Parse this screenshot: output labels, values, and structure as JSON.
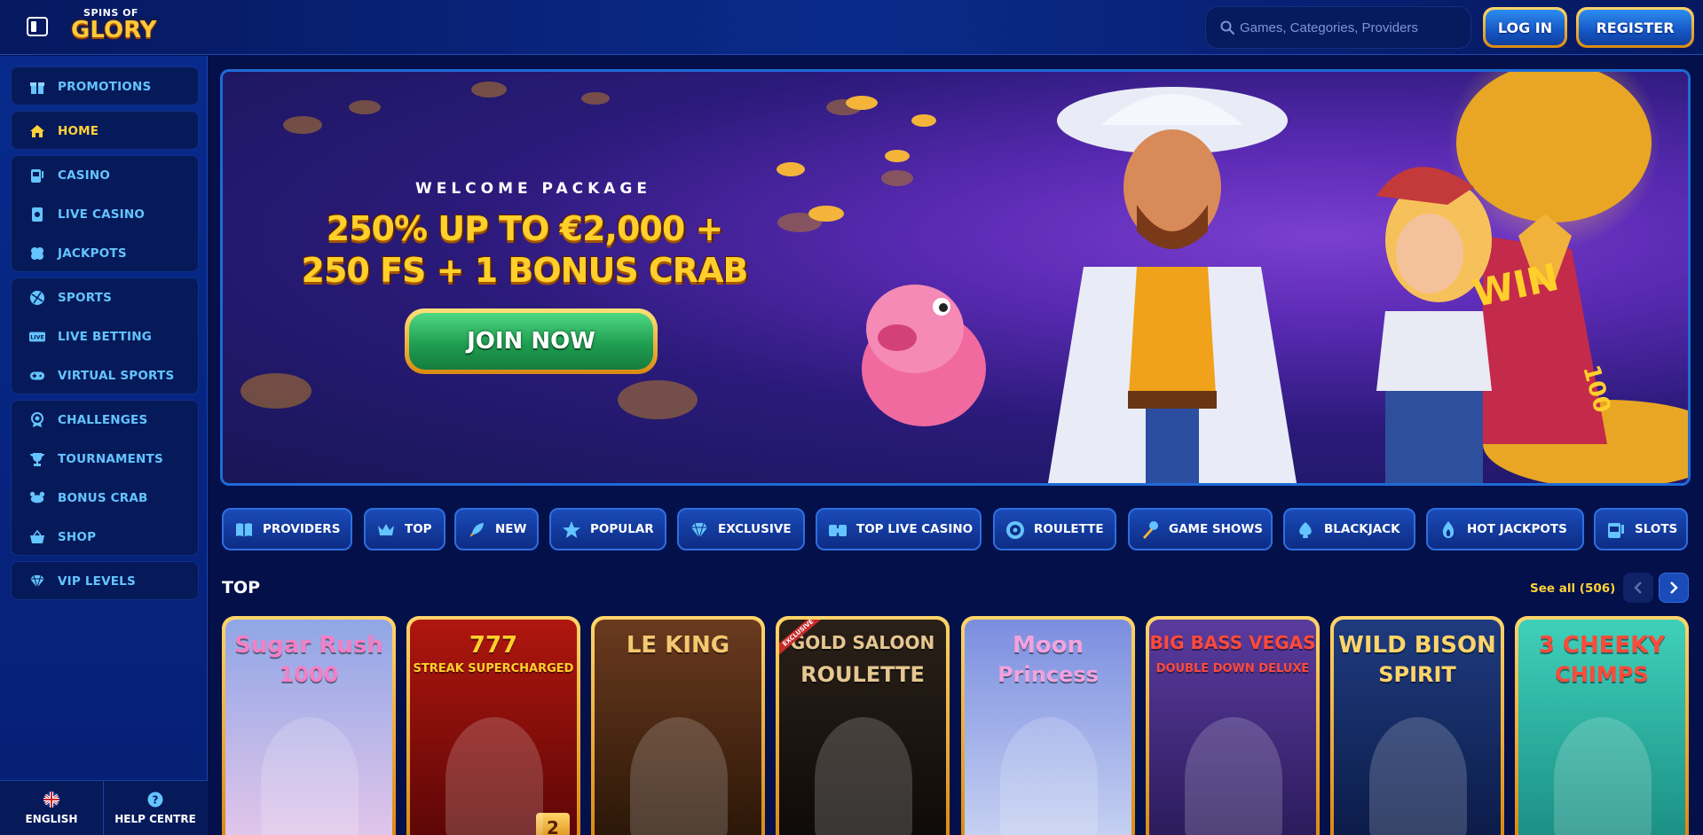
{
  "header": {
    "logo_top": "SPINS OF",
    "logo_main": "GLORY",
    "search_placeholder": "Games, Categories, Providers",
    "login_label": "LOG IN",
    "register_label": "REGISTER"
  },
  "sidebar": {
    "groups": [
      [
        {
          "label": "PROMOTIONS",
          "icon": "gift-icon"
        }
      ],
      [
        {
          "label": "HOME",
          "icon": "home-icon",
          "active": true
        }
      ],
      [
        {
          "label": "CASINO",
          "icon": "slot-machine-icon"
        },
        {
          "label": "LIVE CASINO",
          "icon": "live-card-icon"
        },
        {
          "label": "JACKPOTS",
          "icon": "clover-icon"
        }
      ],
      [
        {
          "label": "SPORTS",
          "icon": "ball-icon"
        },
        {
          "label": "LIVE BETTING",
          "icon": "live-badge-icon"
        },
        {
          "label": "VIRTUAL SPORTS",
          "icon": "gamepad-icon"
        }
      ],
      [
        {
          "label": "CHALLENGES",
          "icon": "medal-icon"
        },
        {
          "label": "TOURNAMENTS",
          "icon": "trophy-icon"
        },
        {
          "label": "BONUS CRAB",
          "icon": "crab-icon"
        },
        {
          "label": "SHOP",
          "icon": "basket-icon"
        }
      ],
      [
        {
          "label": "VIP LEVELS",
          "icon": "diamond-icon"
        }
      ]
    ],
    "footer": {
      "language_label": "ENGLISH",
      "help_label": "HELP CENTRE"
    }
  },
  "hero": {
    "kicker": "WELCOME PACKAGE",
    "line1": "250% UP TO €2,000 +",
    "line2": "250 FS + 1 BONUS CRAB",
    "cta": "JOIN NOW",
    "wheel_text": "WIN",
    "wheel_number": "100"
  },
  "categories": [
    {
      "label": "PROVIDERS",
      "icon": "book-icon"
    },
    {
      "label": "TOP",
      "icon": "crown-icon"
    },
    {
      "label": "NEW",
      "icon": "rocket-icon"
    },
    {
      "label": "POPULAR",
      "icon": "star-icon"
    },
    {
      "label": "EXCLUSIVE",
      "icon": "gem-icon"
    },
    {
      "label": "TOP LIVE CASINO",
      "icon": "live-cards-icon"
    },
    {
      "label": "ROULETTE",
      "icon": "roulette-icon"
    },
    {
      "label": "GAME SHOWS",
      "icon": "microphone-icon"
    },
    {
      "label": "BLACKJACK",
      "icon": "spade-icon"
    },
    {
      "label": "HOT JACKPOTS",
      "icon": "flame-icon"
    },
    {
      "label": "SLOTS",
      "icon": "slot-icon"
    }
  ],
  "top_section": {
    "title": "TOP",
    "see_all": "See all (506)",
    "games": [
      {
        "title_line1": "Sugar Rush",
        "title_line2": "1000",
        "bg_top": "#8fa6e6",
        "bg_bottom": "#e4c6ea",
        "title_color": "#f47fc4"
      },
      {
        "title_line1": "777",
        "title_line2": "STREAK SUPERCHARGED",
        "bg_top": "#b0160f",
        "bg_bottom": "#5a0606",
        "title_color": "#ffcf2b",
        "badge": "2"
      },
      {
        "title_line1": "LE KING",
        "title_line2": "",
        "bg_top": "#6a3a1e",
        "bg_bottom": "#2a1608",
        "title_color": "#f4c870"
      },
      {
        "title_line1": "GOLD SALOON",
        "title_line2": "ROULETTE",
        "bg_top": "#2a2018",
        "bg_bottom": "#0e0a08",
        "title_color": "#e6c792",
        "tag": "EXCLUSIVE"
      },
      {
        "title_line1": "Moon",
        "title_line2": "Princess",
        "bg_top": "#7b8ee0",
        "bg_bottom": "#c7d2f2",
        "title_color": "#f2a3dd"
      },
      {
        "title_line1": "BIG BASS VEGAS",
        "title_line2": "DOUBLE DOWN DELUXE",
        "bg_top": "#5a3b9e",
        "bg_bottom": "#2b1a5a",
        "title_color": "#ff4a3a"
      },
      {
        "title_line1": "WILD BISON",
        "title_line2": "SPIRIT",
        "bg_top": "#1f3b7e",
        "bg_bottom": "#0b1b48",
        "title_color": "#ffd56a"
      },
      {
        "title_line1": "3 CHEEKY",
        "title_line2": "CHIMPS",
        "bg_top": "#3fd0ba",
        "bg_bottom": "#1a8e83",
        "title_color": "#ff4a3a"
      }
    ]
  }
}
